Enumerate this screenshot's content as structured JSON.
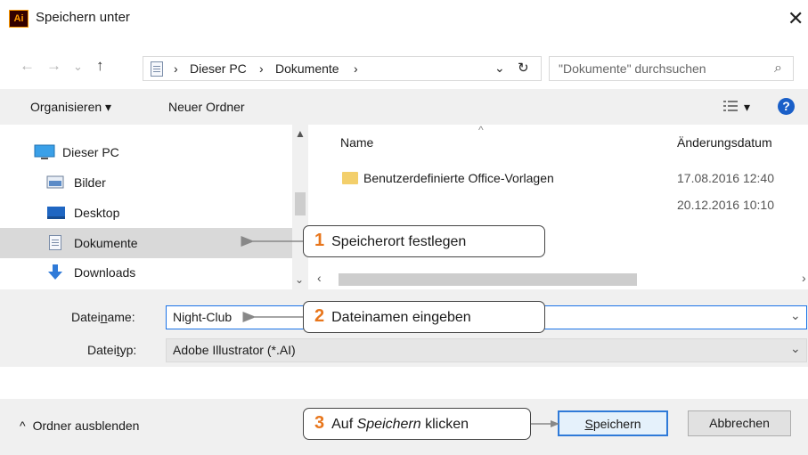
{
  "window": {
    "app_icon": "Ai",
    "title": "Speichern unter",
    "close_glyph": "✕"
  },
  "nav": {
    "back": "←",
    "forward": "→",
    "recent": "⌄",
    "up": "↑"
  },
  "address": {
    "separator": "›",
    "crumbs": [
      "Dieser PC",
      "Dokumente"
    ],
    "dropdown_glyph": "⌄",
    "refresh_glyph": "↻",
    "search_placeholder": "\"Dokumente\" durchsuchen",
    "search_glyph": "⌕"
  },
  "toolbar": {
    "organize": "Organisieren ▾",
    "new_folder": "Neuer Ordner",
    "view_glyph": "▾",
    "help_glyph": "?"
  },
  "sidebar": {
    "items": [
      {
        "label": "Dieser PC",
        "icon": "computer-icon"
      },
      {
        "label": "Bilder",
        "icon": "pictures-icon"
      },
      {
        "label": "Desktop",
        "icon": "desktop-icon"
      },
      {
        "label": "Dokumente",
        "icon": "documents-icon",
        "selected": true
      },
      {
        "label": "Downloads",
        "icon": "downloads-icon"
      }
    ]
  },
  "files": {
    "columns": {
      "name": "Name",
      "modified": "Änderungsdatum"
    },
    "rows": [
      {
        "name": "Benutzerdefinierte Office-Vorlagen",
        "modified": "17.08.2016 12:40"
      },
      {
        "name": "",
        "modified": "20.12.2016 10:10"
      }
    ]
  },
  "form": {
    "filename_label_pre": "Datei",
    "filename_label_u": "n",
    "filename_label_post": "ame:",
    "filename_value": "Night-Club",
    "filetype_label_pre": "Datei",
    "filetype_label_u": "t",
    "filetype_label_post": "yp:",
    "filetype_value": "Adobe Illustrator (*.AI)"
  },
  "footer": {
    "hide_folders": "Ordner ausblenden",
    "save_u": "S",
    "save_rest": "peichern",
    "cancel": "Abbrechen"
  },
  "callouts": [
    {
      "num": "1",
      "text": "Speicherort festlegen"
    },
    {
      "num": "2",
      "text": "Dateinamen eingeben"
    },
    {
      "num": "3",
      "pre": "Auf ",
      "em": "Speichern",
      "post": " klicken"
    }
  ],
  "colors": {
    "accent": "#e8761c",
    "selection": "#d9d9d9",
    "focus": "#1a73e8",
    "help": "#1a5fc8"
  }
}
